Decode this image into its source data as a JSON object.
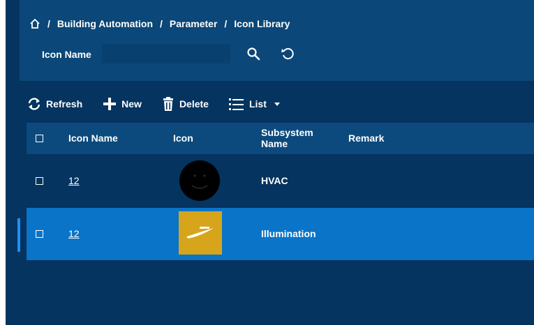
{
  "breadcrumb": {
    "items": [
      "Building Automation",
      "Parameter",
      "Icon Library"
    ],
    "separator": "/"
  },
  "filter": {
    "label": "Icon Name",
    "value": "",
    "placeholder": ""
  },
  "toolbar": {
    "refresh": "Refresh",
    "new": "New",
    "delete": "Delete",
    "view": "List"
  },
  "table": {
    "columns": [
      "Icon Name",
      "Icon",
      "Subsystem Name",
      "Remark"
    ],
    "rows": [
      {
        "icon_name": "12",
        "icon": "smiley-icon",
        "subsystem": "HVAC",
        "remark": ""
      },
      {
        "icon_name": "12",
        "icon": "brand-logo-icon",
        "subsystem": "Illumination",
        "remark": ""
      }
    ]
  },
  "colors": {
    "background": "#04345f",
    "panel": "#0b4778",
    "header": "#0c4a7d",
    "selected_row": "#0a74c8",
    "accent": "#1e90ff"
  }
}
